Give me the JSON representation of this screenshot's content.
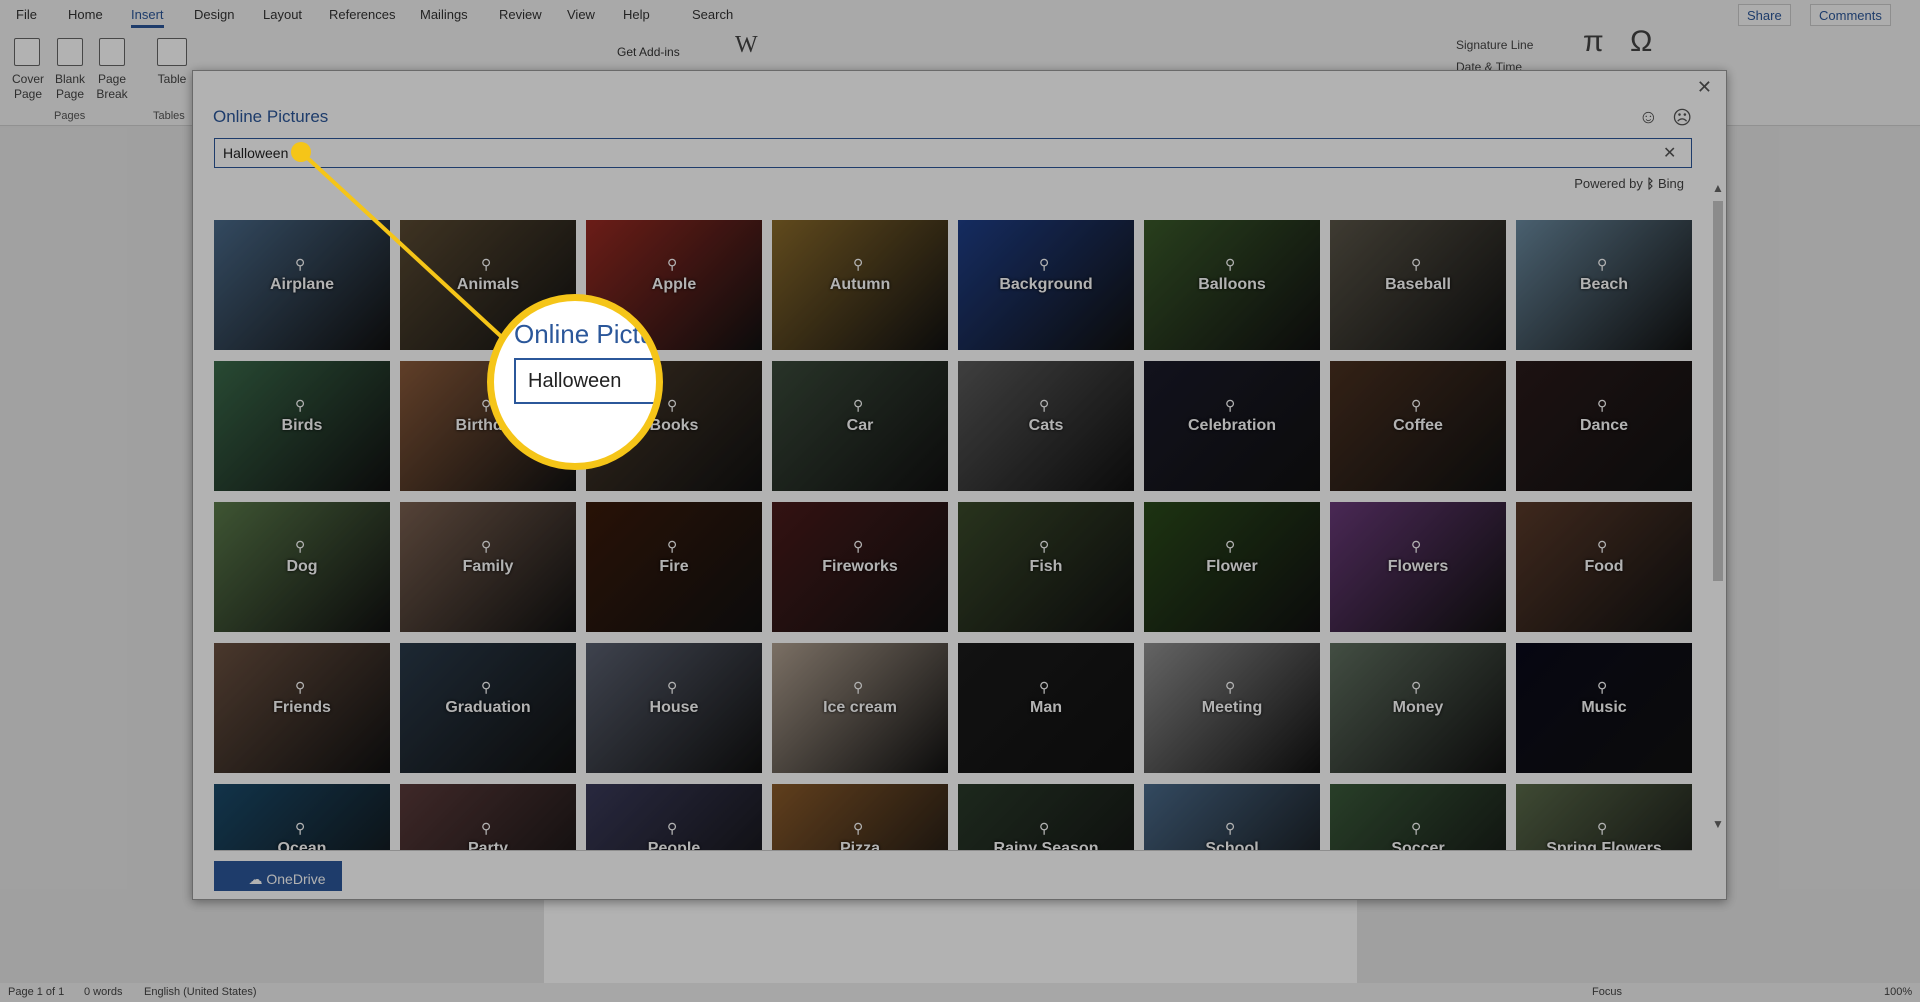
{
  "menu": {
    "tabs": [
      "File",
      "Home",
      "Insert",
      "Design",
      "Layout",
      "References",
      "Mailings",
      "Review",
      "View",
      "Help"
    ],
    "active": "Insert",
    "search": "Search",
    "share": "Share",
    "comments": "Comments"
  },
  "ribbon": {
    "cover_page": "Cover Page",
    "blank_page": "Blank Page",
    "page_break": "Page Break",
    "pages_group": "Pages",
    "table": "Table",
    "tables_group": "Tables",
    "get_addins": "Get Add-ins",
    "wikipedia": "W",
    "signature_line": "Signature Line",
    "date_time": "Date & Time",
    "equation": "π",
    "symbol": "Ω"
  },
  "dialog": {
    "title": "Online Pictures",
    "search_value": "Halloween",
    "powered_by": "Powered by",
    "bing": "Bing",
    "onedrive": "OneDrive",
    "tiles": [
      {
        "label": "Airplane",
        "color": "#4a6a8a"
      },
      {
        "label": "Animals",
        "color": "#5a4a32"
      },
      {
        "label": "Apple",
        "color": "#9a2a22"
      },
      {
        "label": "Autumn",
        "color": "#8a6a2a"
      },
      {
        "label": "Background",
        "color": "#1f3f8a"
      },
      {
        "label": "Balloons",
        "color": "#3a5a2a"
      },
      {
        "label": "Baseball",
        "color": "#5a5548"
      },
      {
        "label": "Beach",
        "color": "#6a8aa0"
      },
      {
        "label": "Birds",
        "color": "#3a6a4a"
      },
      {
        "label": "Birthday",
        "color": "#8a5a3a"
      },
      {
        "label": "Books",
        "color": "#4a3a2a"
      },
      {
        "label": "Car",
        "color": "#3a4a3a"
      },
      {
        "label": "Cats",
        "color": "#5a5a5a"
      },
      {
        "label": "Celebration",
        "color": "#1a1a2a"
      },
      {
        "label": "Coffee",
        "color": "#4a3020"
      },
      {
        "label": "Dance",
        "color": "#2a1a1a"
      },
      {
        "label": "Dog",
        "color": "#5a7a4a"
      },
      {
        "label": "Family",
        "color": "#7a6050"
      },
      {
        "label": "Fire",
        "color": "#3a1a0a"
      },
      {
        "label": "Fireworks",
        "color": "#4a1a1a"
      },
      {
        "label": "Fish",
        "color": "#3a4a2a"
      },
      {
        "label": "Flower",
        "color": "#2a4a1a"
      },
      {
        "label": "Flowers",
        "color": "#6a3a7a"
      },
      {
        "label": "Food",
        "color": "#5a3a2a"
      },
      {
        "label": "Friends",
        "color": "#6a5040"
      },
      {
        "label": "Graduation",
        "color": "#2a3a4a"
      },
      {
        "label": "House",
        "color": "#5a6070"
      },
      {
        "label": "Ice cream",
        "color": "#b0a090"
      },
      {
        "label": "Man",
        "color": "#1a1a1a"
      },
      {
        "label": "Meeting",
        "color": "#909090"
      },
      {
        "label": "Money",
        "color": "#607060"
      },
      {
        "label": "Music",
        "color": "#0a0a1a"
      },
      {
        "label": "Ocean",
        "color": "#1a4a6a"
      },
      {
        "label": "Party",
        "color": "#5a3a3a"
      },
      {
        "label": "People",
        "color": "#3a3a5a"
      },
      {
        "label": "Pizza",
        "color": "#8a5a2a"
      },
      {
        "label": "Rainy Season",
        "color": "#2a3a2a"
      },
      {
        "label": "School",
        "color": "#4a6a8a"
      },
      {
        "label": "Soccer",
        "color": "#3a5a3a"
      },
      {
        "label": "Spring Flowers",
        "color": "#5a6a4a"
      }
    ]
  },
  "callout": {
    "title": "Online Pictu",
    "value": "Halloween",
    "color": "#f5c518"
  },
  "status": {
    "page": "Page 1 of 1",
    "words": "0 words",
    "language": "English (United States)",
    "focus": "Focus",
    "zoom": "100%"
  }
}
